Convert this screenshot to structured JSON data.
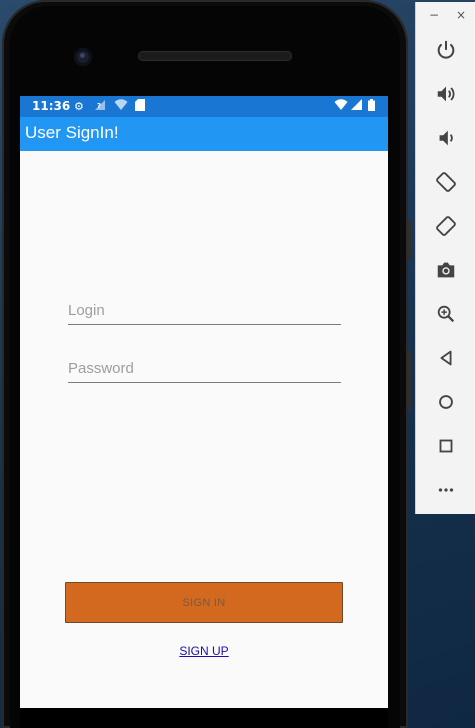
{
  "window": {
    "title": "User SignIn!"
  },
  "status_bar": {
    "time": "11:36",
    "icons": [
      "settings-icon",
      "no-sim-icon",
      "wifi-icon",
      "sd-card-icon",
      "wifi-signal-icon",
      "cell-signal-icon",
      "battery-icon"
    ]
  },
  "form": {
    "login_placeholder": "Login",
    "login_value": "",
    "password_placeholder": "Password",
    "password_value": "",
    "sign_in_label": "SIGN IN",
    "sign_up_label": "SIGN UP"
  },
  "colors": {
    "status_bar": "#1976d2",
    "app_bar": "#2196f3",
    "sign_in_button": "#d2691e",
    "link": "#1a0dab"
  },
  "emulator_toolbar": {
    "minimize_label": "−",
    "close_label": "×",
    "buttons": [
      "power-icon",
      "volume-up-icon",
      "volume-down-icon",
      "rotate-left-icon",
      "rotate-right-icon",
      "camera-icon",
      "zoom-icon",
      "back-icon",
      "home-icon",
      "overview-icon",
      "more-icon"
    ]
  }
}
